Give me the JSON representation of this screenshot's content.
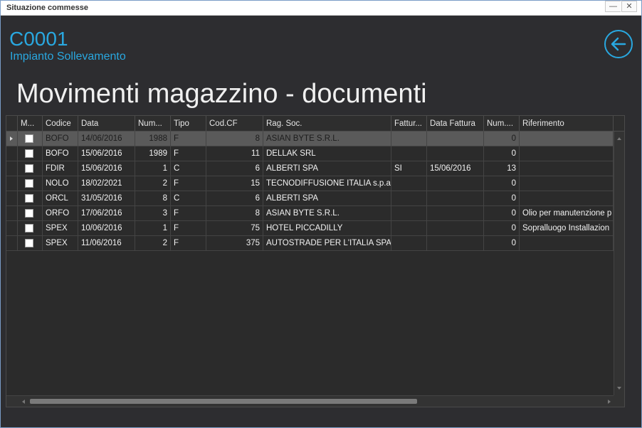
{
  "window": {
    "title": "Situazione commesse",
    "min_label": "—",
    "close_label": "✕"
  },
  "header": {
    "code": "C0001",
    "subtitle": "Impianto Sollevamento",
    "back_icon": "arrow-left-icon"
  },
  "page": {
    "title": "Movimenti magazzino - documenti"
  },
  "grid": {
    "columns": [
      "M...",
      "Codice",
      "Data",
      "Num...",
      "Tipo",
      "Cod.CF",
      "Rag. Soc.",
      "Fattur...",
      "Data Fattura",
      "Num....",
      "Riferimento"
    ],
    "rows": [
      {
        "codice": "BOFO",
        "data": "14/06/2016",
        "num": "1988",
        "tipo": "F",
        "codcf": "8",
        "ragsoc": "ASIAN BYTE S.R.L.",
        "fattura": "",
        "data_fattura": "",
        "num_fatt": "0",
        "riferimento": "",
        "selected": true
      },
      {
        "codice": "BOFO",
        "data": "15/06/2016",
        "num": "1989",
        "tipo": "F",
        "codcf": "11",
        "ragsoc": "DELLAK SRL",
        "fattura": "",
        "data_fattura": "",
        "num_fatt": "0",
        "riferimento": ""
      },
      {
        "codice": "FDIR",
        "data": "15/06/2016",
        "num": "1",
        "tipo": "C",
        "codcf": "6",
        "ragsoc": "ALBERTI SPA",
        "fattura": "SI",
        "data_fattura": "15/06/2016",
        "num_fatt": "13",
        "riferimento": ""
      },
      {
        "codice": "NOLO",
        "data": "18/02/2021",
        "num": "2",
        "tipo": "F",
        "codcf": "15",
        "ragsoc": "TECNODIFFUSIONE ITALIA s.p.a.",
        "fattura": "",
        "data_fattura": "",
        "num_fatt": "0",
        "riferimento": ""
      },
      {
        "codice": "ORCL",
        "data": "31/05/2016",
        "num": "8",
        "tipo": "C",
        "codcf": "6",
        "ragsoc": "ALBERTI SPA",
        "fattura": "",
        "data_fattura": "",
        "num_fatt": "0",
        "riferimento": ""
      },
      {
        "codice": "ORFO",
        "data": "17/06/2016",
        "num": "3",
        "tipo": "F",
        "codcf": "8",
        "ragsoc": "ASIAN BYTE S.R.L.",
        "fattura": "",
        "data_fattura": "",
        "num_fatt": "0",
        "riferimento": "Olio per manutenzione p"
      },
      {
        "codice": "SPEX",
        "data": "10/06/2016",
        "num": "1",
        "tipo": "F",
        "codcf": "75",
        "ragsoc": "HOTEL PICCADILLY",
        "fattura": "",
        "data_fattura": "",
        "num_fatt": "0",
        "riferimento": "Sopralluogo Installazion"
      },
      {
        "codice": "SPEX",
        "data": "11/06/2016",
        "num": "2",
        "tipo": "F",
        "codcf": "375",
        "ragsoc": "AUTOSTRADE PER L'ITALIA SPA",
        "fattura": "",
        "data_fattura": "",
        "num_fatt": "0",
        "riferimento": ""
      }
    ]
  }
}
